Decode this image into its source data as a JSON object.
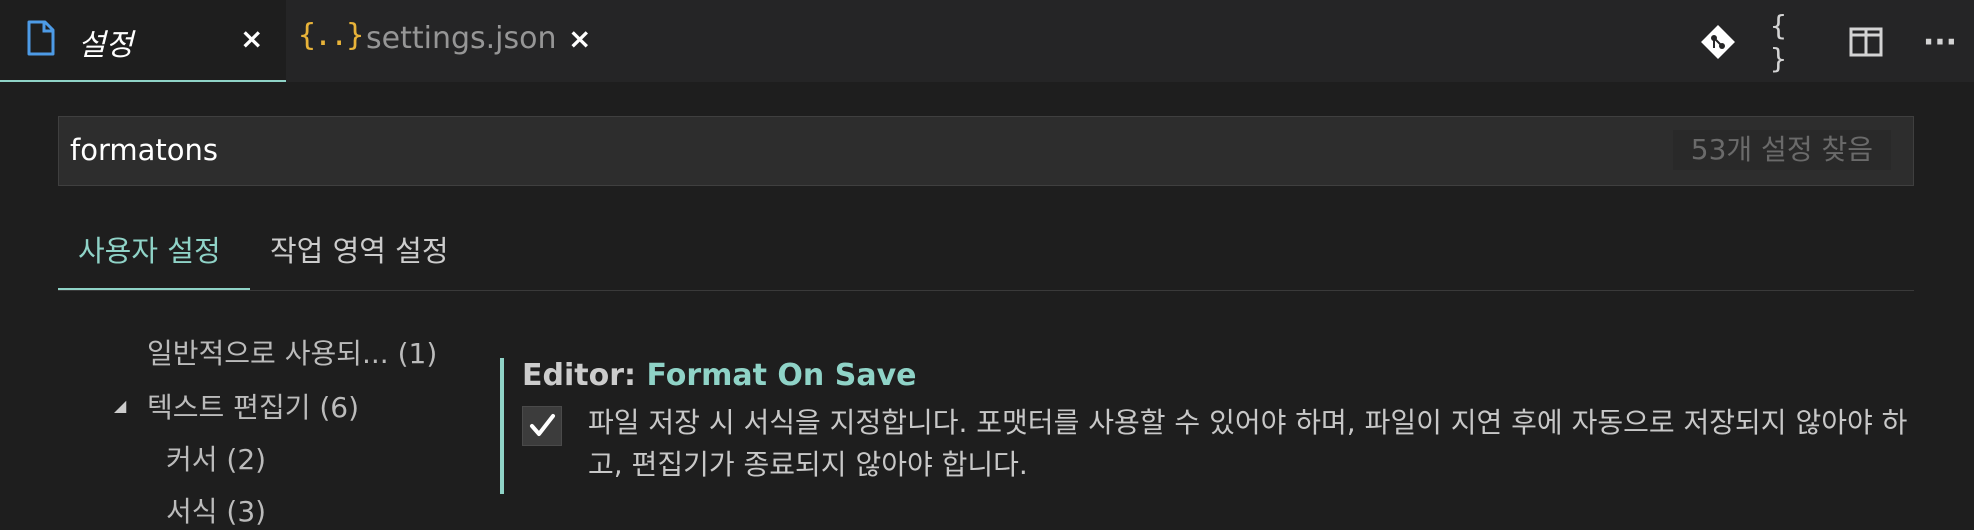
{
  "tabs": [
    {
      "label": "설정",
      "close": "×",
      "active": true
    },
    {
      "label": "settings.json",
      "close": "×",
      "active": false,
      "icon_text": "{..}"
    }
  ],
  "toolbar": {
    "icons": [
      "git-branch-icon",
      "json-braces-icon",
      "split-editor-icon",
      "more-icon"
    ],
    "braces_text": "{ }",
    "more_text": "···"
  },
  "search": {
    "value": "formatons",
    "result_count": "53개 설정 찾음"
  },
  "scopes": {
    "user": "사용자 설정",
    "workspace": "작업 영역 설정"
  },
  "toc": [
    {
      "label": "일반적으로 사용되... (1)"
    },
    {
      "label": "텍스트 편집기 (6)",
      "expanded": true
    },
    {
      "label": "커서 (2)"
    },
    {
      "label": "서식 (3)"
    }
  ],
  "setting": {
    "category": "Editor: ",
    "name": "Format On Save",
    "checked": true,
    "description": "파일 저장 시 서식을 지정합니다. 포맷터를 사용할 수 있어야 하며, 파일이 지연 후에 자동으로 저장되지 않아야 하고, 편집기가 종료되지 않아야 합니다."
  },
  "colors": {
    "accent": "#8fd3c7",
    "json_icon": "#e8b339",
    "file_icon": "#4d9be6"
  }
}
